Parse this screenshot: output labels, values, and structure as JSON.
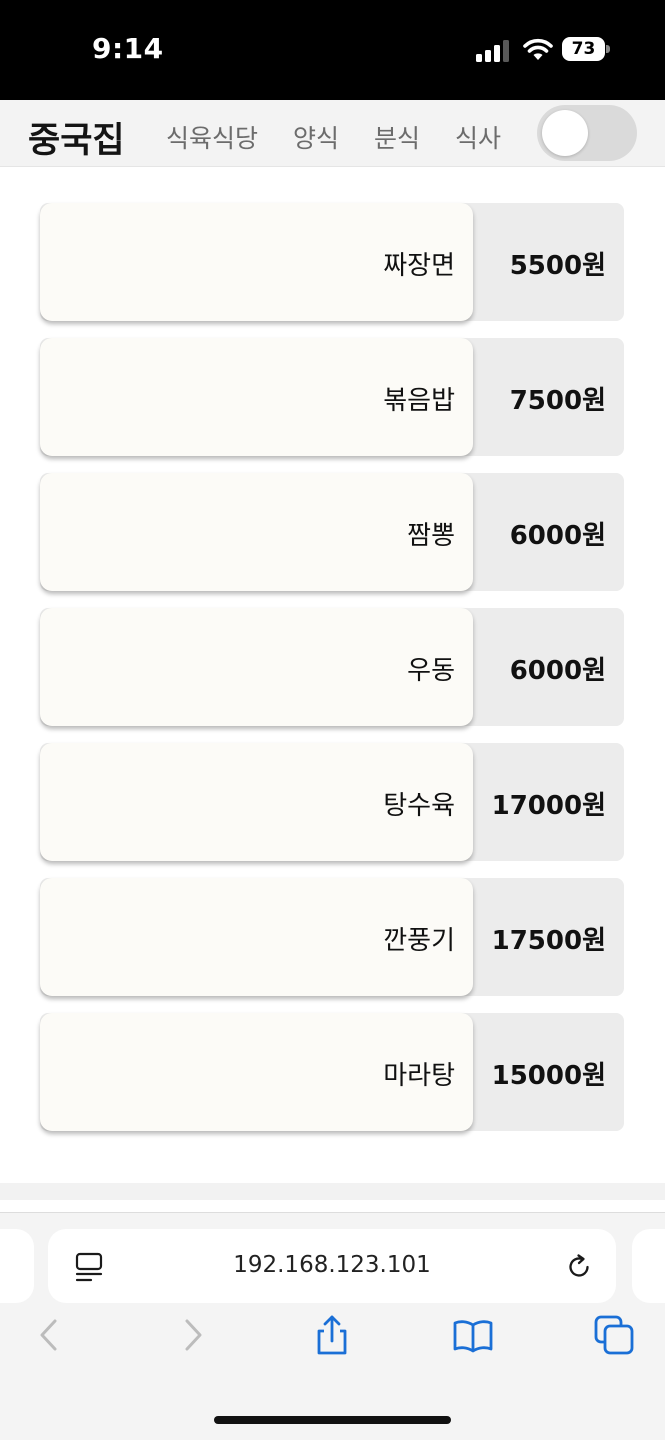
{
  "status_bar": {
    "time": "9:14",
    "battery": "73"
  },
  "nav": {
    "title": "중국집",
    "links": [
      "식육식당",
      "양식",
      "분식",
      "식사"
    ],
    "toggle_on": false
  },
  "menu": {
    "items": [
      {
        "name": "짜장면",
        "price": "5500원"
      },
      {
        "name": "볶음밥",
        "price": "7500원"
      },
      {
        "name": "짬뽕",
        "price": "6000원"
      },
      {
        "name": "우동",
        "price": "6000원"
      },
      {
        "name": "탕수육",
        "price": "17000원"
      },
      {
        "name": "깐풍기",
        "price": "17500원"
      },
      {
        "name": "마라탕",
        "price": "15000원"
      }
    ]
  },
  "browser": {
    "url": "192.168.123.101",
    "icons": [
      "reader-icon",
      "reload-icon",
      "back-icon",
      "forward-icon",
      "share-icon",
      "bookmarks-icon",
      "tabs-icon"
    ],
    "accent_color": "#1a6fd6"
  },
  "colors": {
    "status_bar_bg": "#000000",
    "nav_bg": "#f3f3f3",
    "card_bg": "#fcfbf7",
    "price_bg": "#ececec"
  }
}
